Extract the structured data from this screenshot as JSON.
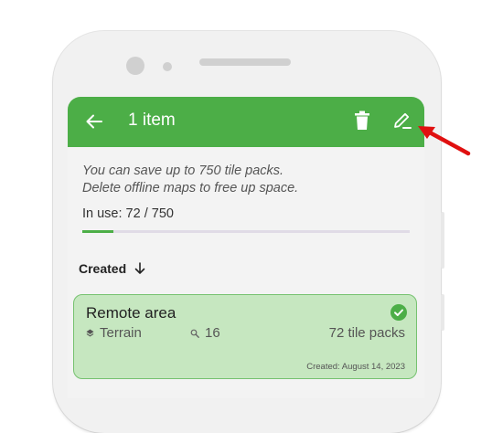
{
  "appbar": {
    "title": "1 item",
    "back_icon": "arrow-left-icon",
    "delete_icon": "trash-icon",
    "edit_icon": "edit-pencil-icon",
    "background_color": "#4cae47"
  },
  "info": {
    "line1": "You can save up to 750 tile packs.",
    "line2": "Delete offline maps to free up space.",
    "in_use": "In use: 72 / 750",
    "usage_fraction": 0.096
  },
  "sort": {
    "label": "Created",
    "icon": "arrow-down-icon"
  },
  "items": [
    {
      "name": "Remote area",
      "layer": "Terrain",
      "zoom": "16",
      "packs": "72 tile packs",
      "created": "Created:  August 14, 2023",
      "selected": true
    }
  ],
  "annotation": {
    "arrow_color": "#e01010"
  }
}
